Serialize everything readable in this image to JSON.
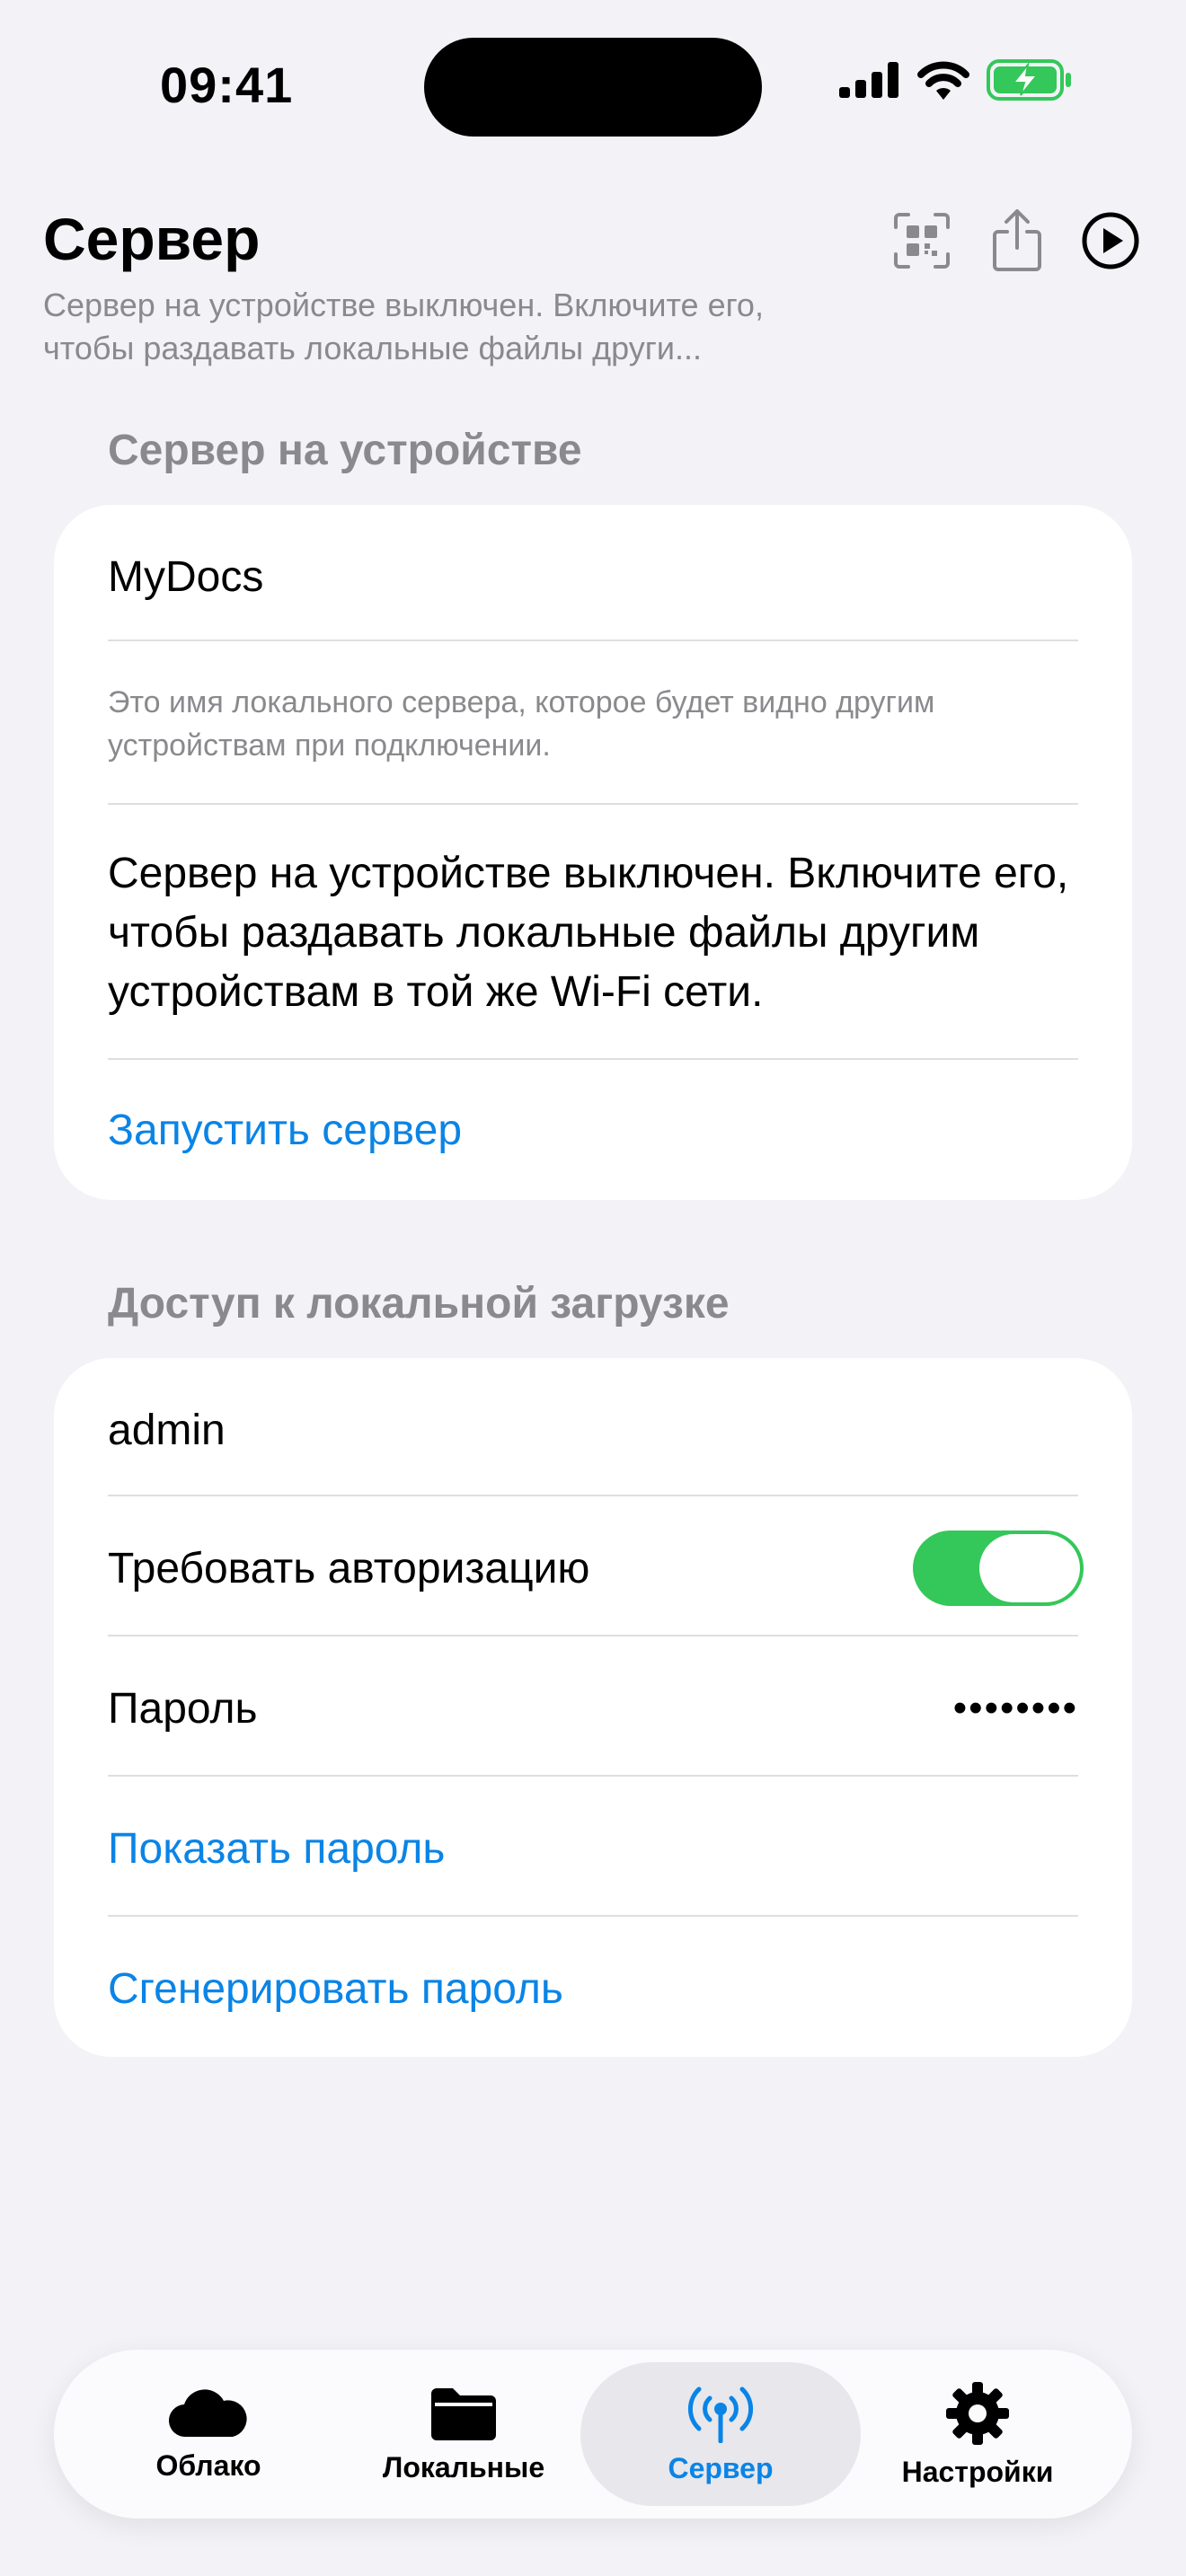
{
  "status_bar": {
    "time": "09:41"
  },
  "header": {
    "title": "Сервер",
    "subtitle": "Сервер на устройстве выключен. Включите его, чтобы раздавать локальные файлы други...",
    "icons": [
      "qr-code-icon",
      "share-icon",
      "play-circle-icon"
    ]
  },
  "server_section": {
    "header": "Сервер на устройстве",
    "server_name": "MyDocs",
    "name_hint": "Это имя локального сервера, которое будет видно другим устройствам при подключении.",
    "status_text": "Сервер на устройстве выключен. Включите его, чтобы раздавать локальные файлы другим устройствам в той же Wi-Fi сети.",
    "start_label": "Запустить сервер"
  },
  "access_section": {
    "header": "Доступ к локальной загрузке",
    "username": "admin",
    "require_auth_label": "Требовать авторизацию",
    "require_auth_on": true,
    "password_label": "Пароль",
    "password_masked": "••••••••",
    "show_password_label": "Показать пароль",
    "generate_password_label": "Сгенерировать пароль"
  },
  "tabbar": {
    "tabs": [
      {
        "label": "Облако",
        "icon": "cloud-icon",
        "active": false
      },
      {
        "label": "Локальные",
        "icon": "folder-icon",
        "active": false
      },
      {
        "label": "Сервер",
        "icon": "antenna-icon",
        "active": true
      },
      {
        "label": "Настройки",
        "icon": "gear-icon",
        "active": false
      }
    ]
  },
  "colors": {
    "accent": "#0a84e6",
    "toggle_on": "#34c759",
    "background": "#f2f2f7",
    "battery": "#34c759"
  }
}
